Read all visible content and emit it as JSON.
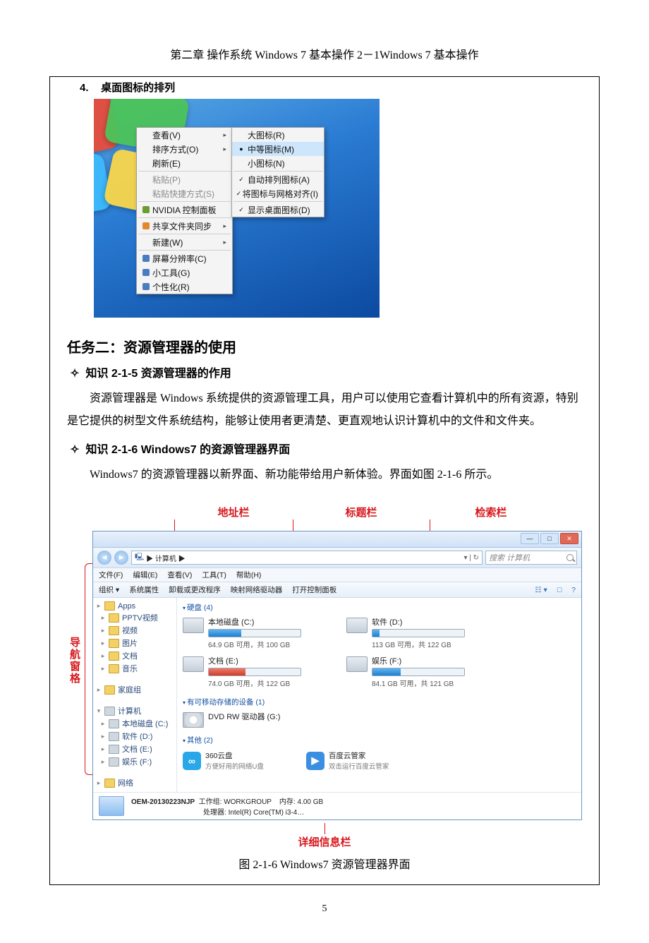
{
  "header": "第二章  操作系统 Windows 7  基本操作   2－1Windows 7  基本操作",
  "section4": {
    "num": "4.",
    "title": "桌面图标的排列"
  },
  "ctx_left": [
    {
      "label": "查看(V)",
      "arrow": true
    },
    {
      "label": "排序方式(O)",
      "arrow": true
    },
    {
      "label": "刷新(E)"
    },
    "hr",
    {
      "label": "粘贴(P)",
      "disabled": true
    },
    {
      "label": "粘贴快捷方式(S)",
      "disabled": true
    },
    "hr",
    {
      "label": "NVIDIA 控制面板",
      "icon": "nvidia"
    },
    "hr",
    {
      "label": "共享文件夹同步",
      "icon": "sync",
      "arrow": true
    },
    "hr",
    {
      "label": "新建(W)",
      "arrow": true
    },
    "hr",
    {
      "label": "屏幕分辨率(C)",
      "icon": "screen"
    },
    {
      "label": "小工具(G)",
      "icon": "gadget"
    },
    {
      "label": "个性化(R)",
      "icon": "theme"
    }
  ],
  "ctx_right": [
    {
      "label": "大图标(R)"
    },
    {
      "label": "中等图标(M)",
      "radio": true,
      "hl": true
    },
    {
      "label": "小图标(N)"
    },
    "hr",
    {
      "label": "自动排列图标(A)",
      "check": true
    },
    {
      "label": "将图标与网格对齐(I)",
      "check": true
    },
    "hr",
    {
      "label": "显示桌面图标(D)",
      "check": true
    }
  ],
  "h2_task2": "任务二：资源管理器的使用",
  "k215_title": "知识 2-1-5 资源管理器的作用",
  "k215_body": "资源管理器是 Windows 系统提供的资源管理工具，用户可以使用它查看计算机中的所有资源，特别是它提供的树型文件系统结构，能够让使用者更清楚、更直观地认识计算机中的文件和文件夹。",
  "k216_title": "知识 2-1-6 Windows7 的资源管理器界面",
  "k216_body": "Windows7 的资源管理器以新界面、新功能带给用户新体验。界面如图 2-1-6 所示。",
  "labels": {
    "addr": "地址栏",
    "title": "标题栏",
    "search": "检索栏",
    "nav": "导航窗格",
    "detail": "详细信息栏"
  },
  "explorer": {
    "breadcrumb": "▶ 计算机 ▶",
    "search_ph": "搜索 计算机",
    "menus": [
      "文件(F)",
      "编辑(E)",
      "查看(V)",
      "工具(T)",
      "帮助(H)"
    ],
    "tools": [
      "组织 ▾",
      "系统属性",
      "卸载或更改程序",
      "映射网络驱动器",
      "打开控制面板"
    ],
    "side": {
      "apps": "Apps",
      "pptv": "PPTV视频",
      "video": "视频",
      "pic": "图片",
      "doc": "文档",
      "music": "音乐",
      "home": "家庭组",
      "computer": "计算机",
      "c": "本地磁盘 (C:)",
      "d": "软件 (D:)",
      "e": "文档 (E:)",
      "f": "娱乐 (F:)",
      "net": "网络"
    },
    "grp_hd": "硬盘 (4)",
    "drives": [
      {
        "name": "本地磁盘 (C:)",
        "free": "64.9 GB 可用，共 100 GB",
        "color": "blue",
        "pct": 35
      },
      {
        "name": "软件 (D:)",
        "free": "113 GB 可用，共 122 GB",
        "color": "blue",
        "pct": 8
      },
      {
        "name": "文档 (E:)",
        "free": "74.0 GB 可用，共 122 GB",
        "color": "red",
        "pct": 40
      },
      {
        "name": "娱乐 (F:)",
        "free": "84.1 GB 可用，共 121 GB",
        "color": "blue",
        "pct": 31
      }
    ],
    "grp_rm": "有可移动存储的设备 (1)",
    "dvd": "DVD RW 驱动器 (G:)",
    "grp_ot": "其他 (2)",
    "apps": [
      {
        "name": "360云盘",
        "desc": "方便好用的网络U盘",
        "cls": "a360",
        "glyph": "∞"
      },
      {
        "name": "百度云管家",
        "desc": "双击运行百度云管家",
        "cls": "abdu",
        "glyph": "▶"
      }
    ],
    "status": {
      "host": "OEM-20130223NJP",
      "wg_l": "工作组:",
      "wg": "WORKGROUP",
      "cpu_l": "处理器:",
      "cpu": "Intel(R) Core(TM) i3-4…",
      "mem_l": "内存:",
      "mem": "4.00 GB"
    }
  },
  "fig_caption": "图 2-1-6  Windows7 资源管理器界面",
  "page_num": "5"
}
